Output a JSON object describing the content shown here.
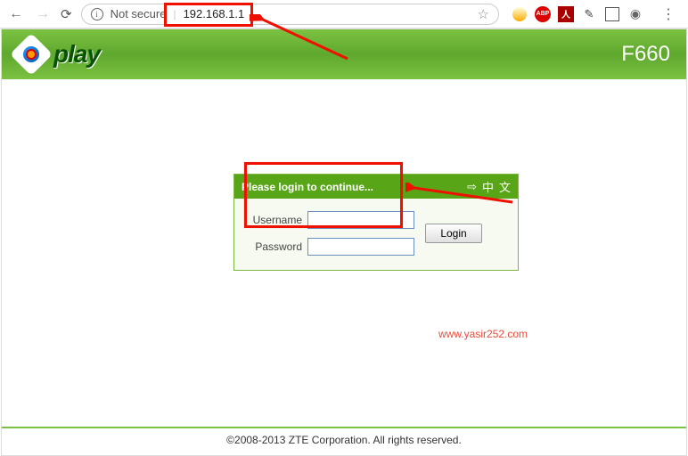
{
  "browser": {
    "not_secure_label": "Not secure",
    "url": "192.168.1.1",
    "ext_abp": "ABP"
  },
  "header": {
    "brand": "play",
    "model": "F660"
  },
  "login": {
    "title": "Please login to continue...",
    "lang_arrow": "⇨",
    "lang_cn1": "中",
    "lang_cn2": "文",
    "username_label": "Username",
    "password_label": "Password",
    "username_value": "",
    "password_value": "",
    "login_button": "Login"
  },
  "watermark": "www.yasir252.com",
  "footer": "©2008-2013 ZTE Corporation. All rights reserved."
}
